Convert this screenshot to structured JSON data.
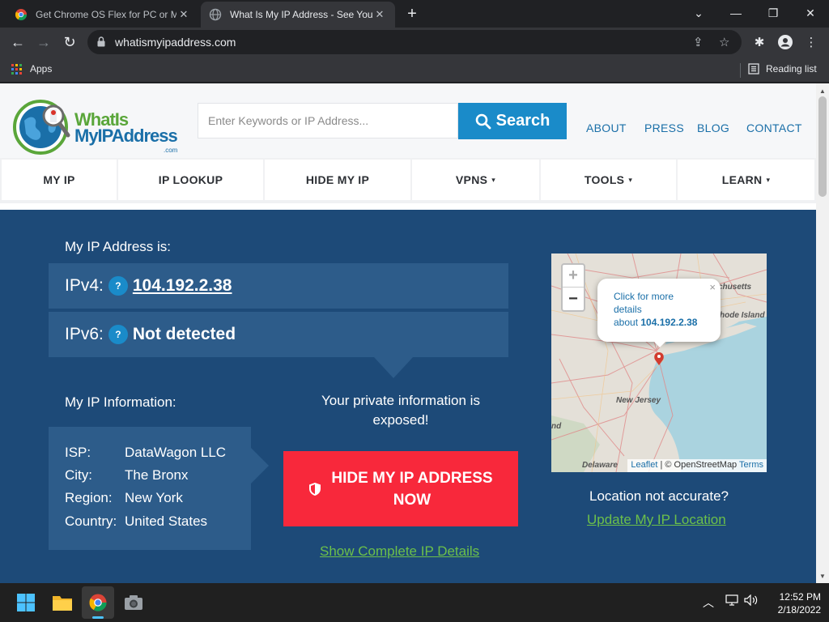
{
  "browser": {
    "tabs": [
      {
        "title": "Get Chrome OS Flex for PC or Mac",
        "active": false
      },
      {
        "title": "What Is My IP Address - See Your Public Address",
        "active": true
      }
    ],
    "url": "whatismyipaddress.com",
    "bookmarks": {
      "apps_label": "Apps",
      "reading_list_label": "Reading list"
    }
  },
  "site": {
    "logo": {
      "line1": "WhatIs",
      "line2": "MyIPAddress",
      "suffix": ".com"
    },
    "search": {
      "placeholder": "Enter Keywords or IP Address...",
      "button_label": "Search"
    },
    "top_links": [
      "ABOUT",
      "PRESS",
      "BLOG",
      "CONTACT"
    ],
    "nav": [
      {
        "label": "MY IP",
        "dropdown": false
      },
      {
        "label": "IP LOOKUP",
        "dropdown": false
      },
      {
        "label": "HIDE MY IP",
        "dropdown": false
      },
      {
        "label": "VPNS",
        "dropdown": true
      },
      {
        "label": "TOOLS",
        "dropdown": true
      },
      {
        "label": "LEARN",
        "dropdown": true
      }
    ],
    "caret_glyph": "▾",
    "hero": {
      "ip_heading": "My IP Address is:",
      "ipv4_label": "IPv4:",
      "ipv4_value": "104.192.2.38",
      "ipv6_label": "IPv6:",
      "ipv6_value": "Not detected",
      "help_glyph": "?",
      "info_heading": "My IP Information:",
      "info": [
        {
          "key": "ISP:",
          "value": "DataWagon LLC"
        },
        {
          "key": "City:",
          "value": "The Bronx"
        },
        {
          "key": "Region:",
          "value": "New York"
        },
        {
          "key": "Country:",
          "value": "United States"
        }
      ],
      "exposed_text": "Your private information is exposed!",
      "hide_button_label": "HIDE MY IP ADDRESS NOW",
      "show_details_link": "Show Complete IP Details",
      "location_question": "Location not accurate?",
      "update_location_link": "Update My IP Location"
    },
    "map": {
      "zoom_in": "+",
      "zoom_out": "−",
      "popup_line1": "Click for more",
      "popup_line2": "details",
      "popup_about": "about",
      "popup_ip": "104.192.2.38",
      "popup_close": "×",
      "labels": [
        "chusetts",
        "hode Island",
        "New Jersey",
        "nd",
        "Delaware"
      ],
      "attribution": {
        "leaflet": "Leaflet",
        "separator": " | © OpenStreetMap ",
        "terms": "Terms"
      }
    }
  },
  "taskbar": {
    "time": "12:52 PM",
    "date": "2/18/2022"
  },
  "colors": {
    "hero_bg": "#1d4a78",
    "panel_bg": "#2d5c8a",
    "accent_blue": "#1a8bc9",
    "hide_red": "#f8283b",
    "link_green": "#6cc04a"
  }
}
